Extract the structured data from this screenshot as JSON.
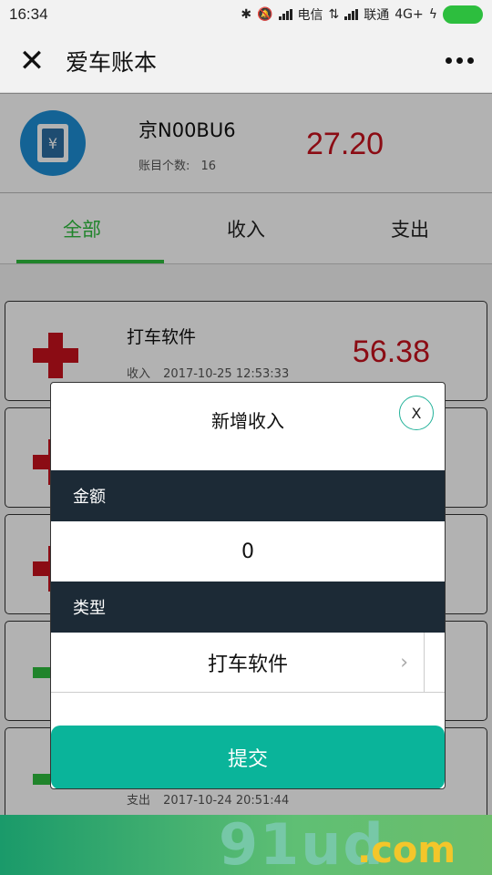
{
  "status_bar": {
    "time": "16:34",
    "carrier1": "电信",
    "carrier2": "联通",
    "network": "4G+"
  },
  "header": {
    "close_glyph": "✕",
    "title": "爱车账本"
  },
  "summary": {
    "plate": "京N00BU6",
    "count_label": "账目个数:",
    "count_value": "16",
    "total": "27.20"
  },
  "tabs": [
    {
      "label": "全部",
      "active": true
    },
    {
      "label": "收入",
      "active": false
    },
    {
      "label": "支出",
      "active": false
    }
  ],
  "records": [
    {
      "name": "打车软件",
      "type": "收入",
      "time": "2017-10-25 12:53:33",
      "amount": "56.38",
      "kind": "income"
    },
    {
      "name": "",
      "type": "",
      "time": "",
      "amount": "",
      "kind": "income"
    },
    {
      "name": "",
      "type": "",
      "time": "",
      "amount": "",
      "kind": "income"
    },
    {
      "name": "",
      "type": "",
      "time": "",
      "amount": "",
      "kind": "expense"
    },
    {
      "name": "",
      "type": "支出",
      "time": "2017-10-24 20:51:44",
      "amount": "",
      "kind": "expense"
    }
  ],
  "modal": {
    "title": "新增收入",
    "close_label": "X",
    "amount_label": "金额",
    "amount_value": "0",
    "type_label": "类型",
    "type_value": "打车软件",
    "submit_label": "提交"
  },
  "watermark": {
    "text": "91ud",
    "suffix": ".com"
  },
  "colors": {
    "accent_green": "#2ebd3e",
    "amount_red": "#c8121e",
    "submit_teal": "#0ab49a",
    "dark_label_bg": "#1c2a36"
  }
}
